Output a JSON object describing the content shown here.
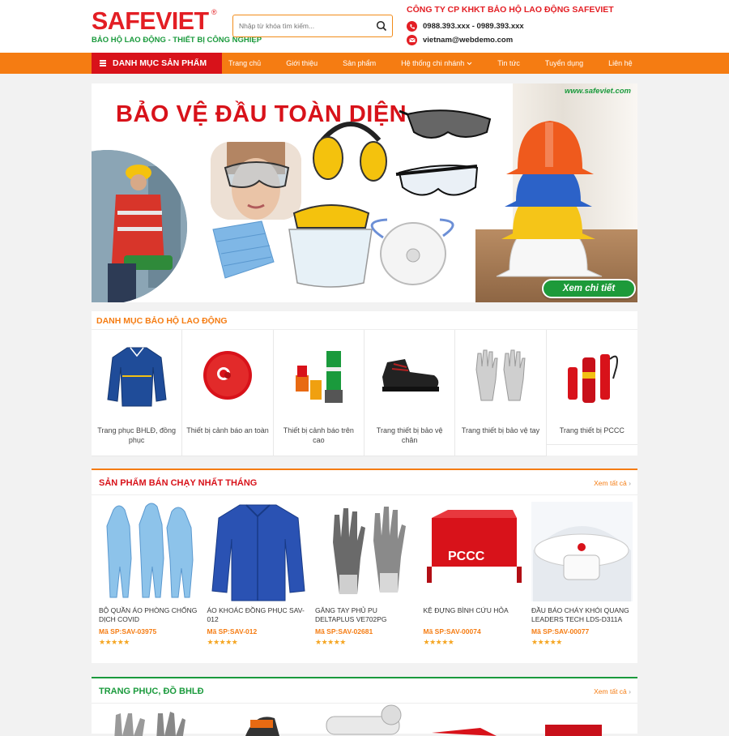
{
  "header": {
    "logo_text": "SAFEVIET",
    "logo_reg": "®",
    "logo_tagline": "BẢO HỘ LAO ĐỘNG - THIẾT BỊ CÔNG NGHIỆP",
    "search_placeholder": "Nhập từ khóa tìm kiếm...",
    "company": "CÔNG TY CP KHKT BẢO HỘ LAO ĐỘNG SAFEVIET",
    "phone": "0988.393.xxx - 0989.393.xxx",
    "email": "vietnam@webdemo.com"
  },
  "nav": {
    "category_button": "DANH MỤC SẢN PHẨM",
    "items": [
      "Trang chủ",
      "Giới thiệu",
      "Sản phẩm",
      "Hệ thống chi nhánh",
      "Tin tức",
      "Tuyển dụng",
      "Liên hệ"
    ]
  },
  "banner": {
    "title": "BẢO VỆ ĐẦU TOÀN DIỆN",
    "url": "www.safeviet.com",
    "button": "Xem chi tiết"
  },
  "categories": {
    "title": "DANH MỤC BẢO HỘ LAO ĐỘNG",
    "items": [
      {
        "label": "Trang phục BHLĐ, đồng phục"
      },
      {
        "label": "Thiết bị cảnh báo an toàn"
      },
      {
        "label": "Thiết bị cảnh báo trên cao"
      },
      {
        "label": "Trang thiết bị bảo vệ chân"
      },
      {
        "label": "Trang thiết bị bảo vệ tay"
      },
      {
        "label": "Trang thiết bị PCCC"
      }
    ]
  },
  "bestsellers": {
    "title": "SẢN PHẨM BÁN CHẠY NHẤT THÁNG",
    "more": "Xem tất cả",
    "products": [
      {
        "name": "BỘ QUẦN ÁO PHÒNG CHỐNG DỊCH COVID",
        "code": "Mã SP:SAV-03975",
        "stars": "★★★★★"
      },
      {
        "name": "ÁO KHOÁC ĐỒNG PHỤC SAV-012",
        "code": "Mã SP:SAV-012",
        "stars": "★★★★★"
      },
      {
        "name": "GĂNG TAY PHỦ PU DELTAPLUS VE702PG",
        "code": "Mã SP:SAV-02681",
        "stars": "★★★★★"
      },
      {
        "name": "KỆ ĐỰNG BÌNH CỨU HỎA",
        "code": "Mã SP:SAV-00074",
        "stars": "★★★★★"
      },
      {
        "name": "ĐẦU BÁO CHÁY KHÓI QUANG LEADERS TECH LDS-D311A",
        "code": "Mã SP:SAV-00077",
        "stars": "★★★★★"
      }
    ]
  },
  "uniforms": {
    "title": "TRANG PHỤC, ĐỒ BHLĐ",
    "more": "Xem tất cả"
  },
  "colors": {
    "brand_red": "#e31e24",
    "nav_orange": "#f57c12",
    "green": "#1a9a3c"
  }
}
